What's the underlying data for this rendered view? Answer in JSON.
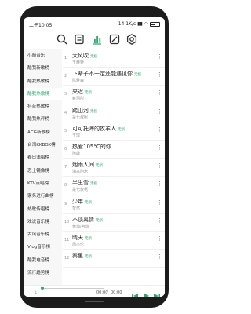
{
  "status": {
    "time": "上午10:05",
    "net_speed": "14.1K/s",
    "battery": "48"
  },
  "toolbar": {
    "icons": [
      "search-icon",
      "playlist-icon",
      "chart-icon",
      "settings-toggle-icon",
      "gear-icon"
    ],
    "accent": "#2eaa6f"
  },
  "sidebar": {
    "items": [
      {
        "label": "小萌音乐"
      },
      {
        "label": "酷我新歌榜"
      },
      {
        "label": "酷我热歌榜"
      },
      {
        "label": "酷我热歌榜"
      },
      {
        "label": "抖音热歌榜"
      },
      {
        "label": "酷我热评榜"
      },
      {
        "label": "ACG新歌榜"
      },
      {
        "label": "台湾KKBOX榜"
      },
      {
        "label": "春日浅唱榜"
      },
      {
        "label": "恋土镜像榜"
      },
      {
        "label": "KTV点唱榜"
      },
      {
        "label": "家务进行曲榜"
      },
      {
        "label": "热歌传唱榜"
      },
      {
        "label": "戏说音乐榜"
      },
      {
        "label": "古风音乐榜"
      },
      {
        "label": "Vlog音乐榜"
      },
      {
        "label": "酷我电音榜"
      },
      {
        "label": "流行趋势榜"
      }
    ],
    "active_index": 3
  },
  "songs": [
    {
      "index": "1",
      "title": "大风吹",
      "tag": "无损",
      "artist": "王赫野"
    },
    {
      "index": "2",
      "title": "下辈子不一定还能遇见你",
      "tag": "无损",
      "artist": "陈雅森"
    },
    {
      "index": "3",
      "title": "来迟",
      "tag": "无损",
      "artist": "戴羽彤"
    },
    {
      "index": "4",
      "title": "踏山河",
      "tag": "无损",
      "artist": "是七叔呢"
    },
    {
      "index": "5",
      "title": "可可托海的牧羊人",
      "tag": "无损",
      "artist": "王琪"
    },
    {
      "index": "6",
      "title": "热爱105°C的你",
      "tag": "",
      "artist": "阿肆"
    },
    {
      "index": "7",
      "title": "烟雨人间",
      "tag": "无损",
      "artist": "海来阿木"
    },
    {
      "index": "8",
      "title": "半生雪",
      "tag": "无损",
      "artist": "是七叔呢"
    },
    {
      "index": "9",
      "title": "少年",
      "tag": "无损",
      "artist": "梦然"
    },
    {
      "index": "10",
      "title": "不谈离情",
      "tag": "无损",
      "artist": "黄灿/阿悠"
    },
    {
      "index": "11",
      "title": "晴天",
      "tag": "无损",
      "artist": "周杰伦"
    },
    {
      "index": "12",
      "title": "秦里",
      "tag": "无损",
      "artist": ""
    }
  ],
  "player": {
    "mode_label": "⤵",
    "current_time": "00:00",
    "total_time": "00:00",
    "progress": 0
  }
}
